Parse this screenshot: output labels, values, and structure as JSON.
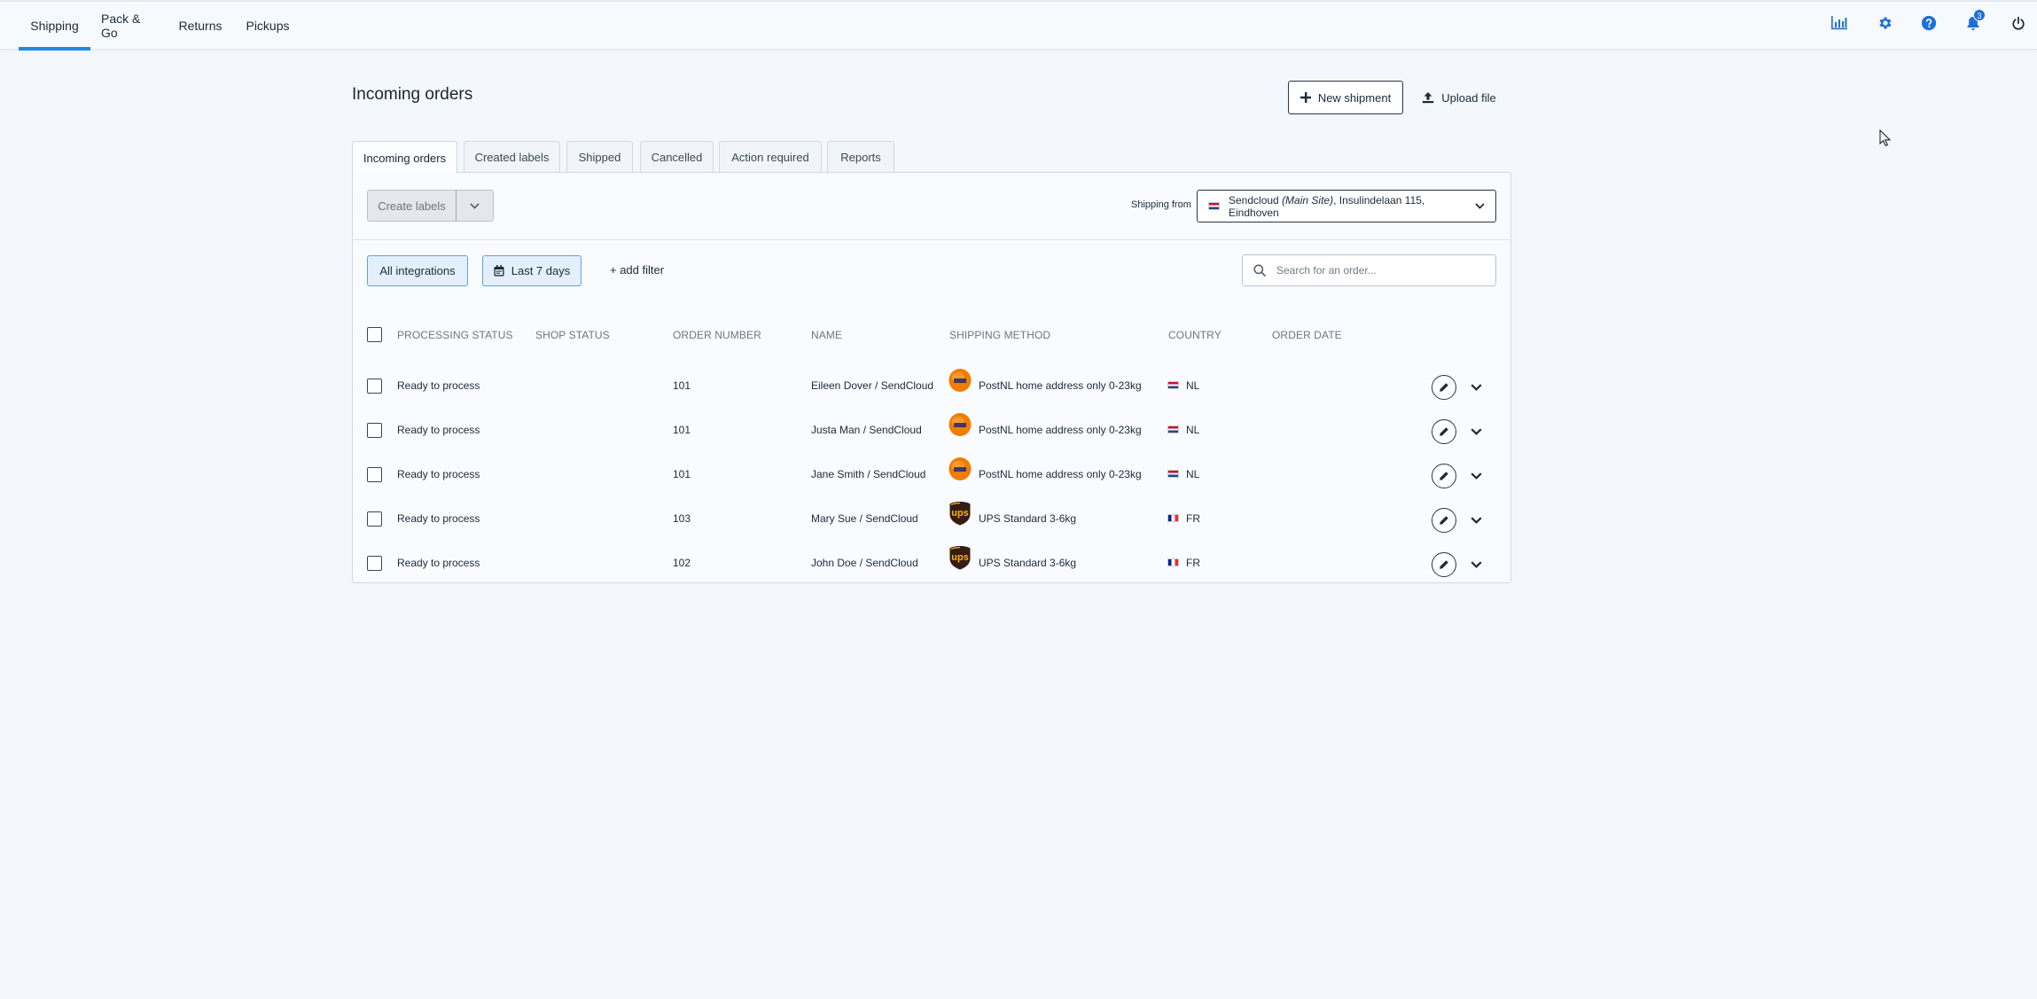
{
  "nav": {
    "tabs": [
      "Shipping",
      "Pack & Go",
      "Returns",
      "Pickups"
    ],
    "active_tab": "Shipping",
    "icons": [
      "analytics-icon",
      "gear-icon",
      "help-icon",
      "bell-icon",
      "power-icon"
    ],
    "notification_count": "3"
  },
  "header": {
    "title": "Incoming orders",
    "new_shipment_label": "New shipment",
    "upload_file_label": "Upload file"
  },
  "tabs": [
    "Incoming orders",
    "Created labels",
    "Shipped",
    "Cancelled",
    "Action required",
    "Reports"
  ],
  "active_tab": "Incoming orders",
  "toolbar": {
    "create_labels": "Create labels",
    "shipping_from_label": "Shipping from",
    "shipping_from_name": "Sendcloud",
    "shipping_from_site": "(Main Site)",
    "shipping_from_address": ", Insulindelaan 115, Eindhoven"
  },
  "filters": {
    "integrations": "All integrations",
    "date_range": "Last 7 days",
    "add_filter": "+ add filter",
    "search_placeholder": "Search for an order..."
  },
  "table": {
    "columns": [
      "PROCESSING STATUS",
      "SHOP STATUS",
      "ORDER NUMBER",
      "NAME",
      "SHIPPING METHOD",
      "COUNTRY",
      "ORDER DATE"
    ],
    "rows": [
      {
        "status": "Ready to process",
        "shop_status": "",
        "order_number": "101",
        "name": "Eileen Dover / SendCloud",
        "carrier": "postnl",
        "method": "PostNL home address only 0-23kg",
        "country": "NL",
        "order_date": ""
      },
      {
        "status": "Ready to process",
        "shop_status": "",
        "order_number": "101",
        "name": "Justa Man / SendCloud",
        "carrier": "postnl",
        "method": "PostNL home address only 0-23kg",
        "country": "NL",
        "order_date": ""
      },
      {
        "status": "Ready to process",
        "shop_status": "",
        "order_number": "101",
        "name": "Jane Smith / SendCloud",
        "carrier": "postnl",
        "method": "PostNL home address only 0-23kg",
        "country": "NL",
        "order_date": ""
      },
      {
        "status": "Ready to process",
        "shop_status": "",
        "order_number": "103",
        "name": "Mary Sue / SendCloud",
        "carrier": "ups",
        "method": "UPS Standard 3-6kg",
        "country": "FR",
        "order_date": ""
      },
      {
        "status": "Ready to process",
        "shop_status": "",
        "order_number": "102",
        "name": "John Doe / SendCloud",
        "carrier": "ups",
        "method": "UPS Standard 3-6kg",
        "country": "FR",
        "order_date": ""
      }
    ]
  },
  "colors": {
    "accent": "#1e88e5",
    "background": "#f4f8fd",
    "postnl": "#f07c00",
    "ups_brown": "#351c15",
    "ups_gold": "#ffb500"
  }
}
